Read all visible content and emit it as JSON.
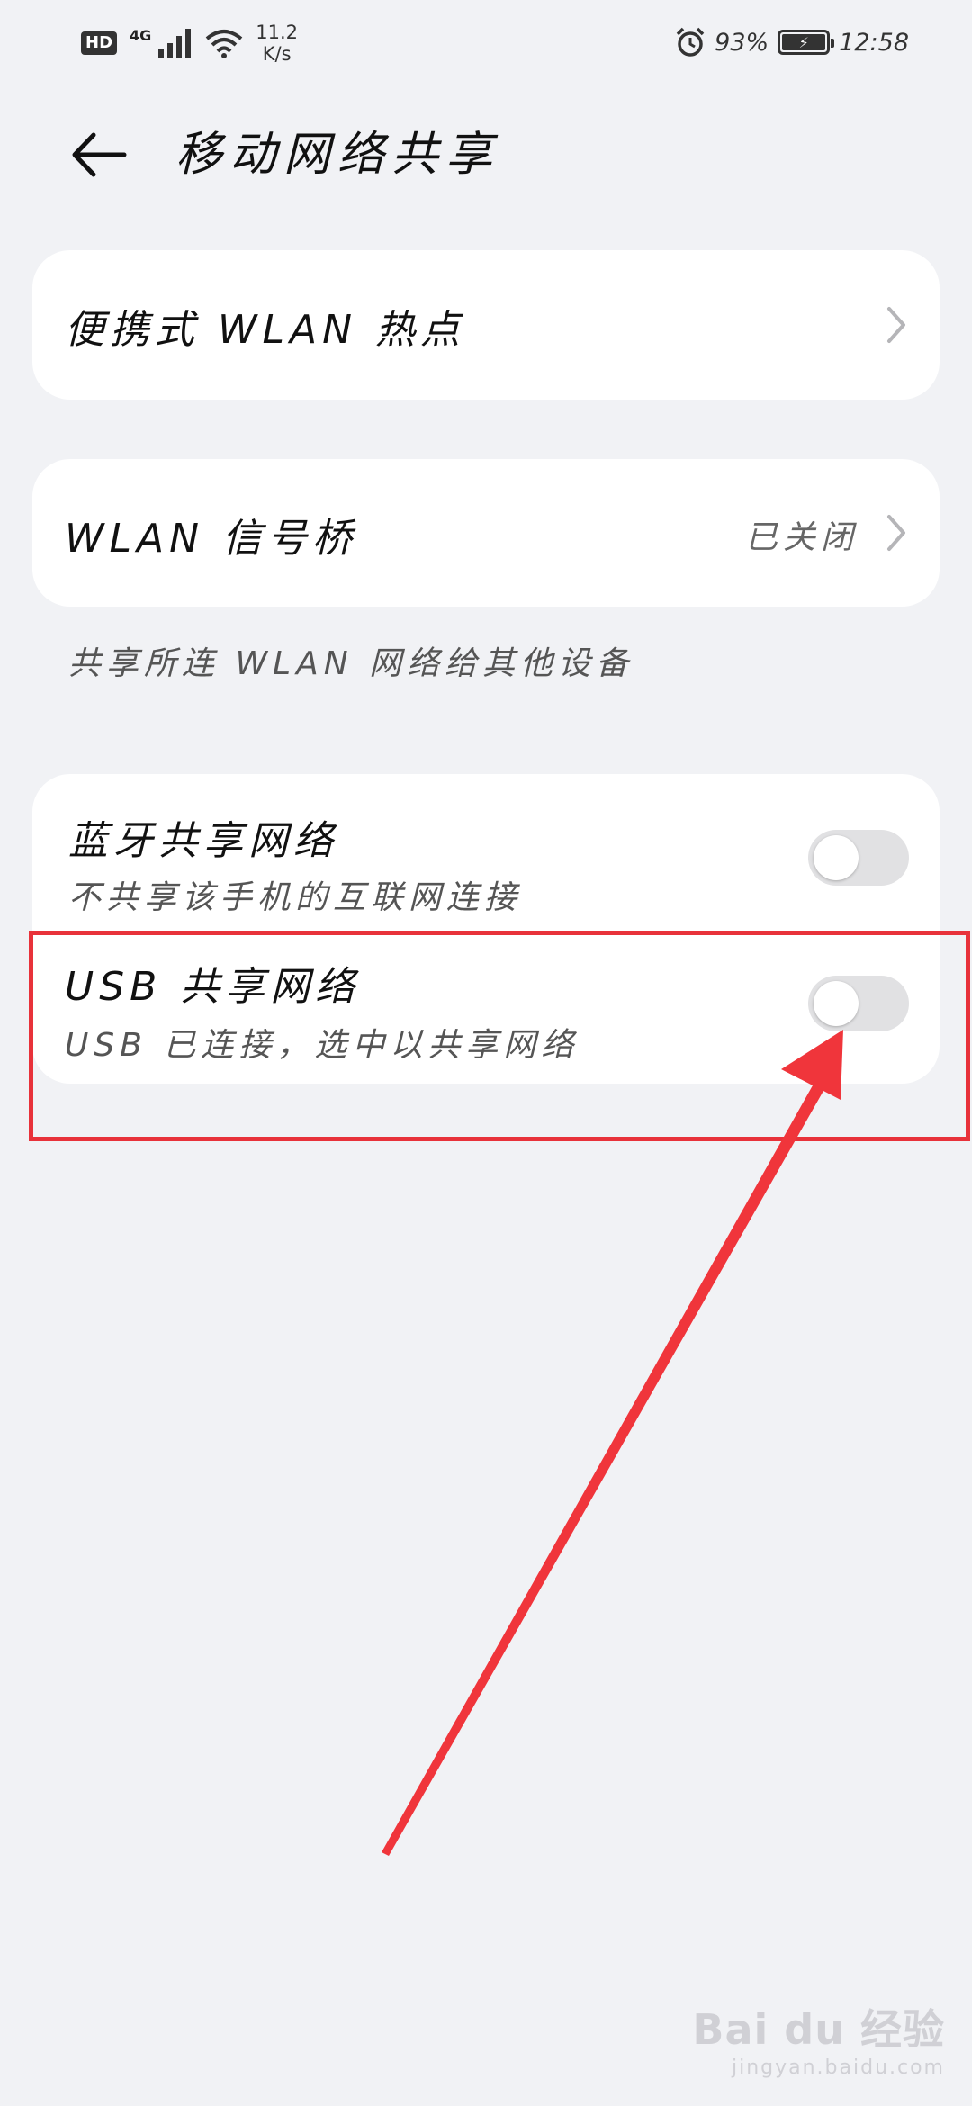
{
  "status_bar": {
    "hd": "HD",
    "network": "4G",
    "speed_value": "11.2",
    "speed_unit": "K/s",
    "battery_percent": "93%",
    "time": "12:58"
  },
  "header": {
    "title": "移动网络共享"
  },
  "hotspot": {
    "label": "便携式 WLAN 热点"
  },
  "bridge": {
    "label": "WLAN 信号桥",
    "status": "已关闭",
    "description": "共享所连 WLAN 网络给其他设备"
  },
  "bluetooth_tether": {
    "label": "蓝牙共享网络",
    "subtitle": "不共享该手机的互联网连接",
    "enabled": false
  },
  "usb_tether": {
    "label": "USB 共享网络",
    "subtitle": "USB 已连接，选中以共享网络",
    "enabled": false
  },
  "annotation": {
    "color": "#f0353b"
  },
  "watermark": {
    "brand": "Bai du 经验",
    "url": "jingyan.baidu.com"
  },
  "colors": {
    "background": "#f1f2f5",
    "card": "#ffffff",
    "toggle_off": "#e1e1e3"
  }
}
